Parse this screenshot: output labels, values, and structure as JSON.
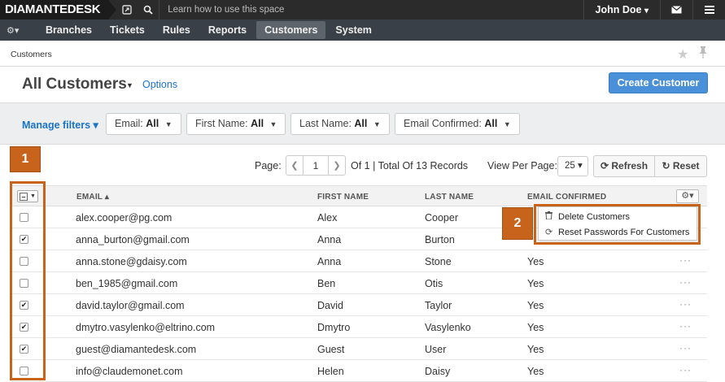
{
  "topbar": {
    "logo": "DIAMANTEDESK",
    "learn_text": "Learn how to use this space",
    "user_name": "John Doe",
    "caret": "▾"
  },
  "nav": {
    "dashboard_icon": "⚙▾",
    "items": [
      {
        "label": "Branches",
        "active": false
      },
      {
        "label": "Tickets",
        "active": false
      },
      {
        "label": "Rules",
        "active": false
      },
      {
        "label": "Reports",
        "active": false
      },
      {
        "label": "Customers",
        "active": true
      },
      {
        "label": "System",
        "active": false
      }
    ]
  },
  "breadcrumb": {
    "current": "Customers"
  },
  "page": {
    "title": "All Customers",
    "title_caret": "▼",
    "options_link": "Options",
    "create_button": "Create Customer"
  },
  "filters": {
    "manage_label": "Manage filters ▾",
    "items": [
      {
        "name": "Email:",
        "value": "All"
      },
      {
        "name": "First Name:",
        "value": "All"
      },
      {
        "name": "Last Name:",
        "value": "All"
      },
      {
        "name": "Email Confirmed:",
        "value": "All"
      }
    ]
  },
  "pager": {
    "page_label": "Page:",
    "current_page": "1",
    "total_text": "Of 1 | Total Of 13 Records",
    "view_per_page_label": "View Per Page:",
    "per_page": "25 ▾",
    "refresh_label": "Refresh",
    "reset_label": "Reset"
  },
  "table": {
    "columns": [
      "EMAIL ▴",
      "FIRST NAME",
      "LAST NAME",
      "EMAIL CONFIRMED"
    ],
    "rows": [
      {
        "checked": false,
        "email": "alex.cooper@pg.com",
        "first": "Alex",
        "last": "Cooper",
        "confirmed": ""
      },
      {
        "checked": true,
        "email": "anna_burton@gmail.com",
        "first": "Anna",
        "last": "Burton",
        "confirmed": ""
      },
      {
        "checked": false,
        "email": "anna.stone@gdaisy.com",
        "first": "Anna",
        "last": "Stone",
        "confirmed": "Yes"
      },
      {
        "checked": false,
        "email": "ben_1985@gmail.com",
        "first": "Ben",
        "last": "Otis",
        "confirmed": "Yes"
      },
      {
        "checked": true,
        "email": "david.taylor@gmail.com",
        "first": "David",
        "last": "Taylor",
        "confirmed": "Yes"
      },
      {
        "checked": true,
        "email": "dmytro.vasylenko@eltrino.com",
        "first": "Dmytro",
        "last": "Vasylenko",
        "confirmed": "Yes"
      },
      {
        "checked": true,
        "email": "guest@diamantedesk.com",
        "first": "Guest",
        "last": "User",
        "confirmed": "Yes"
      },
      {
        "checked": false,
        "email": "info@claudemonet.com",
        "first": "Helen",
        "last": "Daisy",
        "confirmed": "Yes"
      }
    ],
    "row_actions": "···"
  },
  "mass_actions": {
    "items": [
      {
        "label": "Delete Customers",
        "icon": "trash-icon"
      },
      {
        "label": "Reset Passwords For Customers",
        "icon": "refresh-icon"
      }
    ]
  },
  "callouts": [
    "1",
    "2"
  ],
  "colors": {
    "accent": "#1a73c8",
    "primary_button": "#4a90d9",
    "callout": "#c8631c",
    "topbar": "#2b2b2b",
    "navbar": "#3a4047"
  }
}
